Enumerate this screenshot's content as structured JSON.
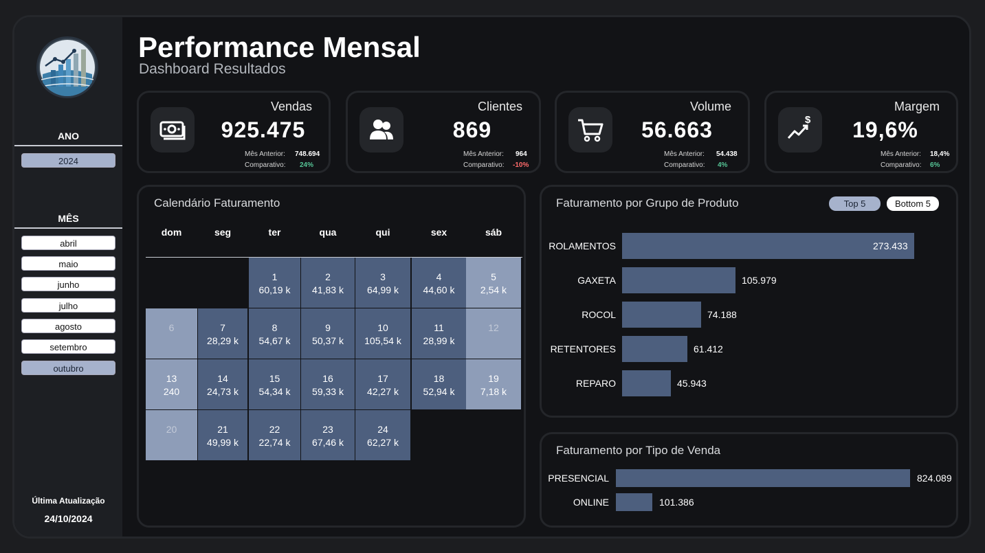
{
  "header": {
    "title": "Performance Mensal",
    "subtitle": "Dashboard Resultados"
  },
  "sidebar": {
    "year_title": "ANO",
    "years": [
      {
        "label": "2024",
        "selected": true
      }
    ],
    "month_title": "MÊS",
    "months": [
      {
        "label": "abril",
        "selected": false
      },
      {
        "label": "maio",
        "selected": false
      },
      {
        "label": "junho",
        "selected": false
      },
      {
        "label": "julho",
        "selected": false
      },
      {
        "label": "agosto",
        "selected": false
      },
      {
        "label": "setembro",
        "selected": false
      },
      {
        "label": "outubro",
        "selected": true
      }
    ],
    "update_label": "Última Atualização",
    "update_date": "24/10/2024"
  },
  "kpis": [
    {
      "label": "Vendas",
      "value": "925.475",
      "prev_label": "Mês Anterior:",
      "prev_value": "748.694",
      "cmp_label": "Comparativo:",
      "cmp_value": "24%",
      "trend": "up",
      "icon": "money-icon"
    },
    {
      "label": "Clientes",
      "value": "869",
      "prev_label": "Mês Anterior:",
      "prev_value": "964",
      "cmp_label": "Comparativo:",
      "cmp_value": "-10%",
      "trend": "down",
      "icon": "users-icon"
    },
    {
      "label": "Volume",
      "value": "56.663",
      "prev_label": "Mês Anterior:",
      "prev_value": "54.438",
      "cmp_label": "Comparativo:",
      "cmp_value": "4%",
      "trend": "up",
      "icon": "cart-icon"
    },
    {
      "label": "Margem",
      "value": "19,6%",
      "prev_label": "Mês Anterior:",
      "prev_value": "18,4%",
      "cmp_label": "Comparativo:",
      "cmp_value": "6%",
      "trend": "up",
      "icon": "growth-icon"
    }
  ],
  "calendar": {
    "title": "Calendário Faturamento",
    "weekdays": [
      "dom",
      "seg",
      "ter",
      "qua",
      "qui",
      "sex",
      "sáb"
    ],
    "weeks": [
      [
        null,
        null,
        {
          "day": "1",
          "value": "60,19 k"
        },
        {
          "day": "2",
          "value": "41,83 k"
        },
        {
          "day": "3",
          "value": "64,99 k"
        },
        {
          "day": "4",
          "value": "44,60 k"
        },
        {
          "day": "5",
          "value": "2,54 k"
        }
      ],
      [
        {
          "day": "6",
          "value": ""
        },
        {
          "day": "7",
          "value": "28,29 k"
        },
        {
          "day": "8",
          "value": "54,67 k"
        },
        {
          "day": "9",
          "value": "50,37 k"
        },
        {
          "day": "10",
          "value": "105,54 k"
        },
        {
          "day": "11",
          "value": "28,99 k"
        },
        {
          "day": "12",
          "value": ""
        }
      ],
      [
        {
          "day": "13",
          "value": "240"
        },
        {
          "day": "14",
          "value": "24,73 k"
        },
        {
          "day": "15",
          "value": "54,34 k"
        },
        {
          "day": "16",
          "value": "59,33 k"
        },
        {
          "day": "17",
          "value": "42,27 k"
        },
        {
          "day": "18",
          "value": "52,94 k"
        },
        {
          "day": "19",
          "value": "7,18 k"
        }
      ],
      [
        {
          "day": "20",
          "value": ""
        },
        {
          "day": "21",
          "value": "49,99 k"
        },
        {
          "day": "22",
          "value": "22,74 k"
        },
        {
          "day": "23",
          "value": "67,46 k"
        },
        {
          "day": "24",
          "value": "62,27 k"
        },
        null,
        null
      ]
    ]
  },
  "product_groups": {
    "title": "Faturamento por Grupo de Produto",
    "toggle_top": "Top 5",
    "toggle_bottom": "Bottom 5",
    "selected_toggle": "Top 5",
    "items": [
      {
        "label": "ROLAMENTOS",
        "value": 273433,
        "display": "273.433"
      },
      {
        "label": "GAXETA",
        "value": 105979,
        "display": "105.979"
      },
      {
        "label": "ROCOL",
        "value": 74188,
        "display": "74.188"
      },
      {
        "label": "RETENTORES",
        "value": 61412,
        "display": "61.412"
      },
      {
        "label": "REPARO",
        "value": 45943,
        "display": "45.943"
      }
    ]
  },
  "sale_types": {
    "title": "Faturamento por Tipo de Venda",
    "items": [
      {
        "label": "PRESENCIAL",
        "value": 824089,
        "display": "824.089"
      },
      {
        "label": "ONLINE",
        "value": 101386,
        "display": "101.386"
      }
    ]
  },
  "colors": {
    "bar": "#4d5f7e",
    "weekend": "#8e9db8",
    "positive": "#56c596",
    "negative": "#ff6b6b",
    "selected_pill": "#a6b2cc"
  }
}
